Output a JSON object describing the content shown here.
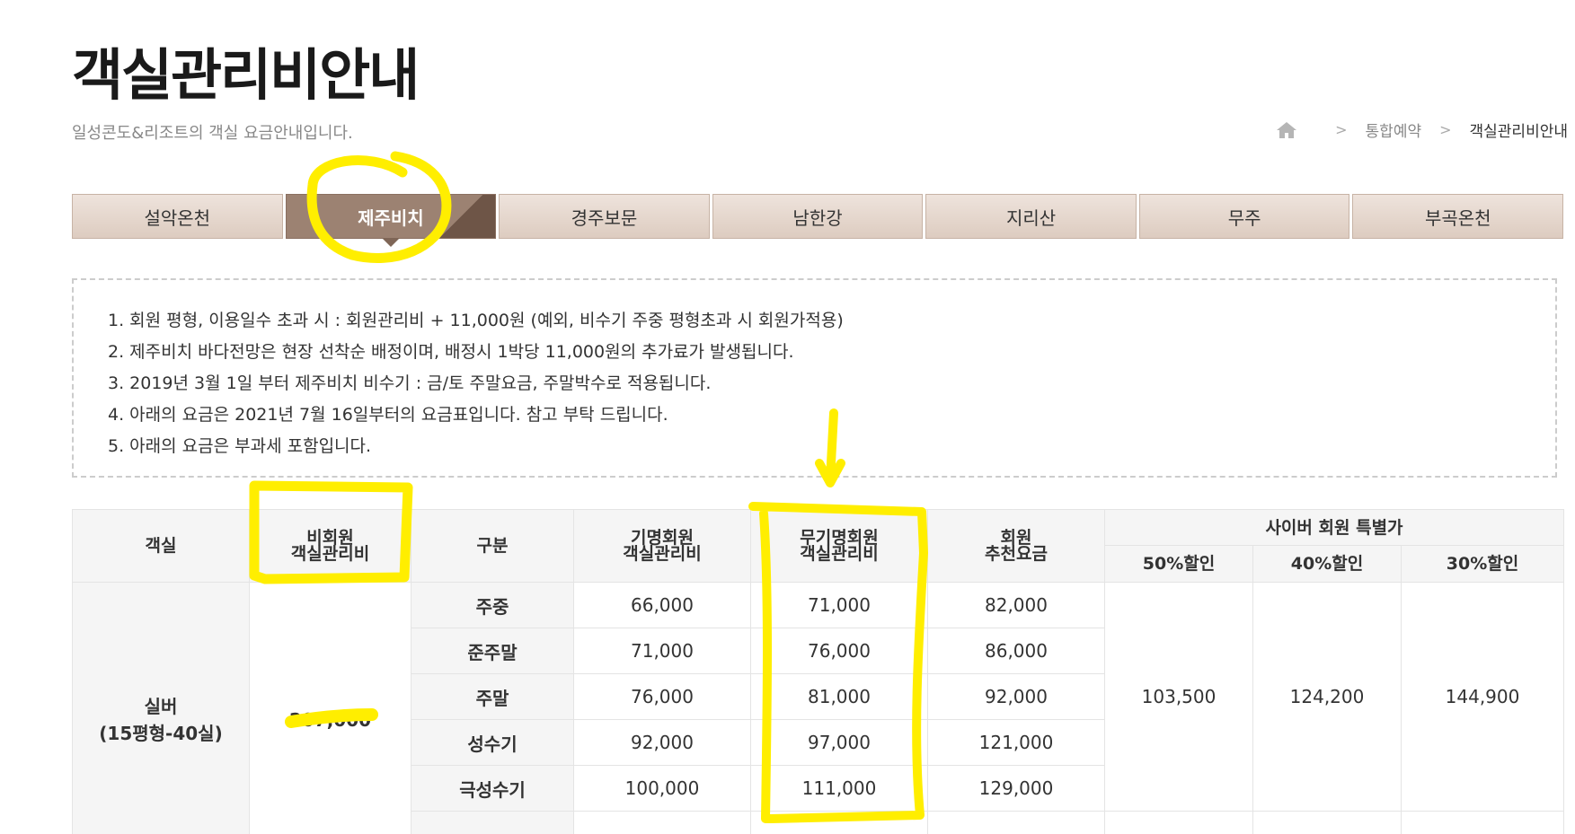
{
  "header": {
    "title": "객실관리비안내",
    "subtitle": "일성콘도&리조트의 객실 요금안내입니다."
  },
  "breadcrumb": {
    "home_icon": "home-icon",
    "items": [
      "통합예약",
      "객실관리비안내"
    ]
  },
  "tabs": [
    {
      "label": "설악온천",
      "active": false
    },
    {
      "label": "제주비치",
      "active": true
    },
    {
      "label": "경주보문",
      "active": false
    },
    {
      "label": "남한강",
      "active": false
    },
    {
      "label": "지리산",
      "active": false
    },
    {
      "label": "무주",
      "active": false
    },
    {
      "label": "부곡온천",
      "active": false
    }
  ],
  "notice": [
    "1. 회원 평형, 이용일수 초과 시 : 회원관리비 + 11,000원 (예외, 비수기 주중 평형초과 시 회원가적용)",
    "2. 제주비치 바다전망은 현장 선착순 배정이며, 배정시 1박당 11,000원의 추가료가 발생됩니다.",
    "3. 2019년 3월 1일 부터 제주비치 비수기 : 금/토 주말요금, 주말박수로 적용됩니다.",
    "4. 아래의 요금은 2021년 7월 16일부터의 요금표입니다. 참고 부탁 드립니다.",
    "5. 아래의 요금은 부과세 포함입니다."
  ],
  "table": {
    "headers": {
      "room": "객실",
      "nonmember_1": "비회원",
      "nonmember_2": "객실관리비",
      "category": "구분",
      "named_1": "기명회원",
      "named_2": "객실관리비",
      "anon_1": "무기명회원",
      "anon_2": "객실관리비",
      "referral_1": "회원",
      "referral_2": "추천요금",
      "cyber": "사이버 회원 특별가",
      "d50": "50%할인",
      "d40": "40%할인",
      "d30": "30%할인"
    },
    "room_1": "실버",
    "room_2": "(15평형-40실)",
    "nonmember_fee": "207,000",
    "rows": [
      {
        "category": "주중",
        "named": "66,000",
        "anon": "71,000",
        "referral": "82,000"
      },
      {
        "category": "준주말",
        "named": "71,000",
        "anon": "76,000",
        "referral": "86,000"
      },
      {
        "category": "주말",
        "named": "76,000",
        "anon": "81,000",
        "referral": "92,000"
      },
      {
        "category": "성수기",
        "named": "92,000",
        "anon": "97,000",
        "referral": "121,000"
      },
      {
        "category": "극성수기",
        "named": "100,000",
        "anon": "111,000",
        "referral": "129,000"
      }
    ],
    "cyber_prices": {
      "d50": "103,500",
      "d40": "124,200",
      "d30": "144,900"
    }
  },
  "annotation_color": "#ffee00"
}
